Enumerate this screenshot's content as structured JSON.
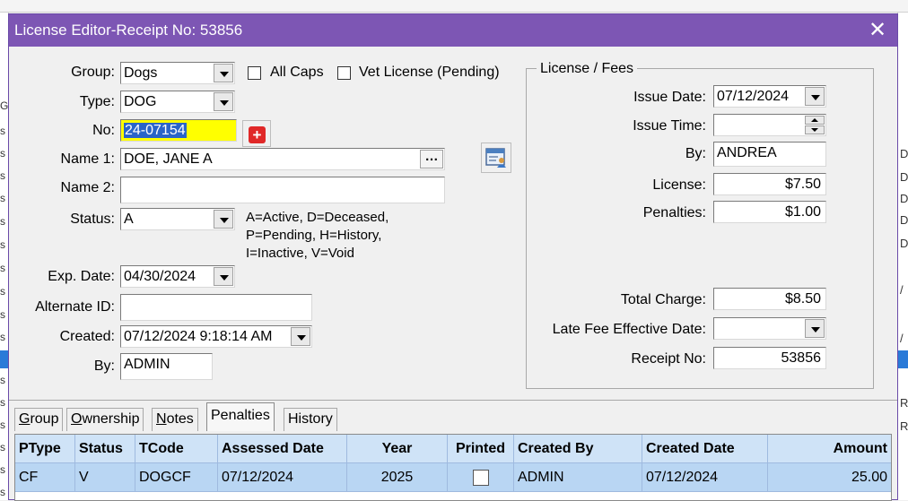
{
  "window": {
    "title": "License Editor-Receipt No: 53856"
  },
  "form": {
    "group": {
      "label": "Group:",
      "value": "Dogs"
    },
    "all_caps": {
      "label": "All Caps",
      "checked": false
    },
    "vet_license": {
      "label": "Vet License (Pending)",
      "checked": false
    },
    "type": {
      "label": "Type:",
      "value": "DOG"
    },
    "no": {
      "label": "No:",
      "value": "24-07154"
    },
    "name1": {
      "label": "Name 1:",
      "value": "DOE, JANE A"
    },
    "name2": {
      "label": "Name 2:",
      "value": ""
    },
    "status": {
      "label": "Status:",
      "value": "A"
    },
    "status_help": [
      "A=Active, D=Deceased,",
      "P=Pending, H=History,",
      "I=Inactive,  V=Void"
    ],
    "exp_date": {
      "label": "Exp. Date:",
      "value": "04/30/2024"
    },
    "alternate_id": {
      "label": "Alternate ID:",
      "value": ""
    },
    "created": {
      "label": "Created:",
      "value": "07/12/2024 9:18:14 AM"
    },
    "by": {
      "label": "By:",
      "value": "ADMIN"
    }
  },
  "fees": {
    "title": "License / Fees",
    "issue_date": {
      "label": "Issue Date:",
      "value": "07/12/2024"
    },
    "issue_time": {
      "label": "Issue Time:",
      "value": ""
    },
    "by": {
      "label": "By:",
      "value": "ANDREA"
    },
    "license": {
      "label": "License:",
      "value": "$7.50"
    },
    "penalties": {
      "label": "Penalties:",
      "value": "$1.00"
    },
    "total_charge": {
      "label": "Total Charge:",
      "value": "$8.50"
    },
    "late_fee_date": {
      "label": "Late Fee Effective Date:",
      "value": ""
    },
    "receipt_no": {
      "label": "Receipt No:",
      "value": "53856"
    }
  },
  "tabs": {
    "group": {
      "first": "G",
      "rest": "roup"
    },
    "ownership": {
      "first": "O",
      "rest": "wnership"
    },
    "notes": {
      "first": "N",
      "rest": "otes"
    },
    "penalties": "Penalties",
    "history": "History",
    "active": "Penalties"
  },
  "grid": {
    "headers": {
      "ptype": "PType",
      "status": "Status",
      "tcode": "TCode",
      "assessed_date": "Assessed Date",
      "year": "Year",
      "printed": "Printed",
      "created_by": "Created By",
      "created_date": "Created Date",
      "amount": "Amount"
    },
    "rows": [
      {
        "ptype": "CF",
        "status": "V",
        "tcode": "DOGCF",
        "assessed_date": "07/12/2024",
        "year": "2025",
        "printed": false,
        "created_by": "ADMIN",
        "created_date": "07/12/2024",
        "amount": "25.00"
      }
    ]
  },
  "background": {
    "left_chars": [
      "G",
      "s",
      "s",
      "s",
      "s",
      "s",
      "s",
      "s",
      "s",
      "s",
      "s",
      "s",
      "s",
      "s",
      "s",
      "s",
      "s",
      "s"
    ],
    "right_chars": [
      "D",
      "D",
      "D",
      "D",
      "D",
      "/",
      "/",
      "R",
      "R"
    ]
  },
  "colors": {
    "titlebar": "#7d56b4",
    "no_highlight": "#ffff00",
    "grid_header": "#cfe3f7",
    "grid_row": "#b9d6f3"
  }
}
